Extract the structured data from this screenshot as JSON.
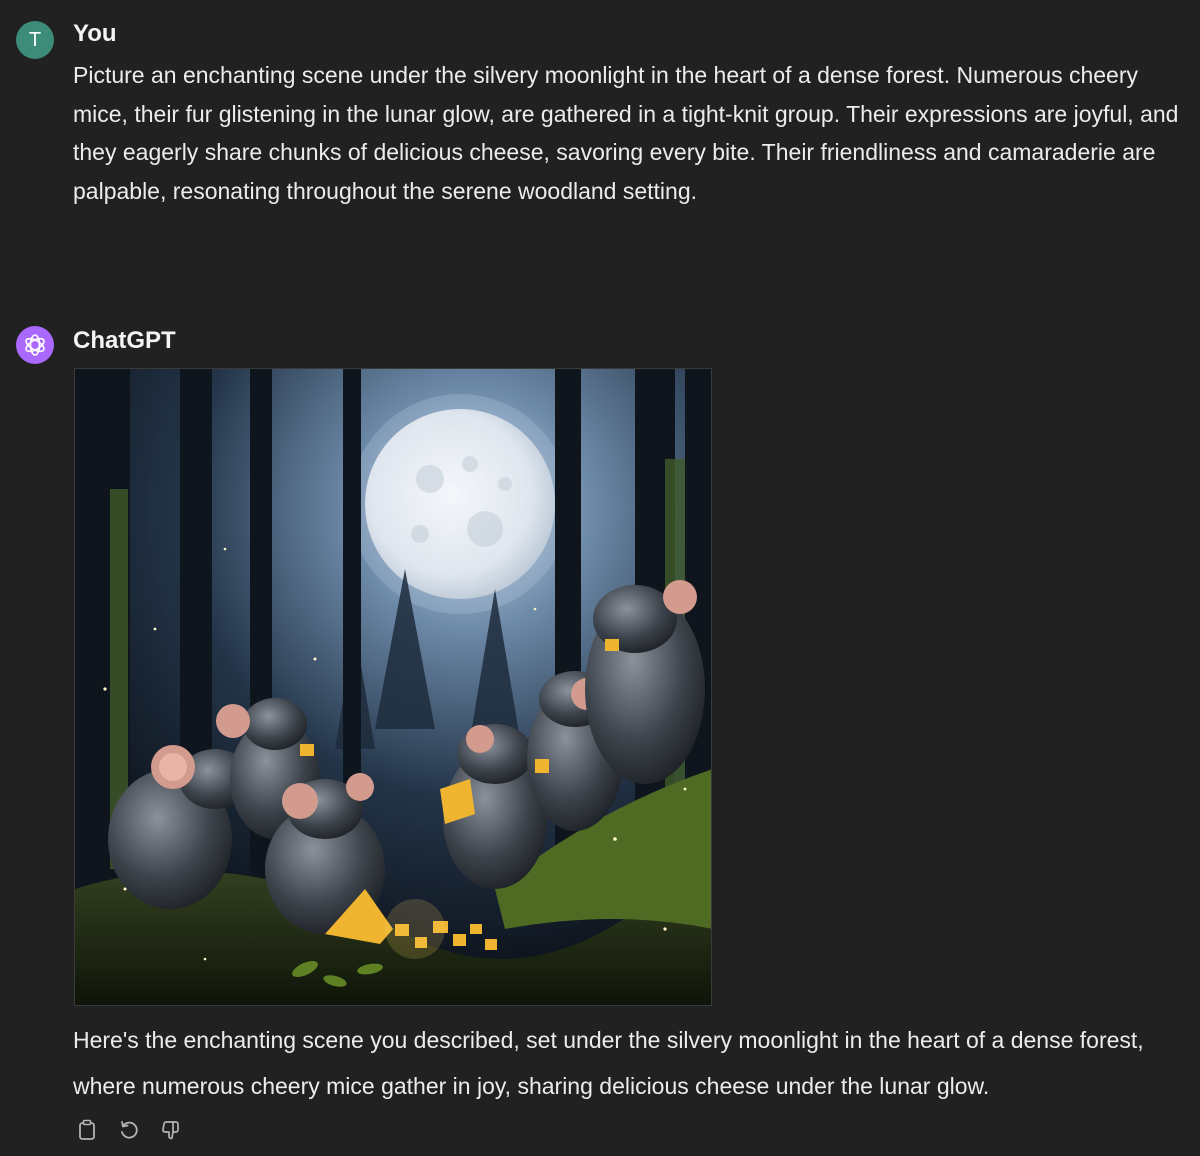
{
  "user": {
    "avatar_initial": "T",
    "name": "You",
    "message": "Picture an enchanting scene under the silvery moonlight in the heart of a dense forest. Numerous cheery mice, their fur glistening in the lunar glow, are gathered in a tight-knit group. Their expressions are joyful, and they eagerly share chunks of delicious cheese, savoring every bite. Their friendliness and camaraderie are palpable, resonating throughout the serene woodland setting."
  },
  "assistant": {
    "name": "ChatGPT",
    "avatar_icon": "openai-logo-icon",
    "image_subject": "mice-sharing-cheese-in-moonlit-forest",
    "message": "Here's the enchanting scene you described, set under the silvery moonlight in the heart of a dense forest, where numerous cheery mice gather in joy, sharing delicious cheese under the lunar glow."
  },
  "actions": [
    {
      "icon": "copy-icon"
    },
    {
      "icon": "regenerate-icon"
    },
    {
      "icon": "thumbs-down-icon"
    }
  ],
  "colors": {
    "background": "#212121",
    "text": "#ececec",
    "user_avatar": "#3d8c7a",
    "assistant_avatar": "#ab68ff"
  }
}
